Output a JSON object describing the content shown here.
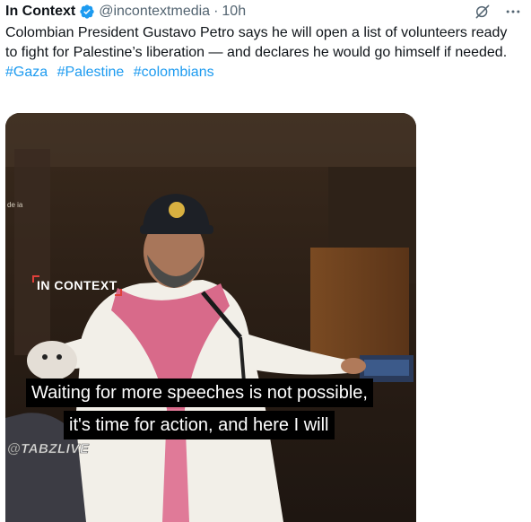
{
  "tweet": {
    "author_name": "In Context",
    "handle": "@incontextmedia",
    "separator": "·",
    "time": "10h",
    "text": "Colombian President Gustavo Petro says he will open a list of volunteers ready to fight for Palestine’s liberation — and declares he would go himself if needed.",
    "hashtags": [
      "#Gaza",
      "#Palestine",
      "#colombians"
    ],
    "icons": {
      "verified": "verified-badge-icon",
      "grok": "grok-icon",
      "more": "more-icon"
    },
    "colors": {
      "link": "#1d9bf0",
      "verified": "#1d9bf0",
      "muted": "#536471"
    }
  },
  "media": {
    "watermark_top": "IN CONTEXT",
    "subtitles": [
      "Waiting for more speeches is not possible,",
      "it's time for action, and here I will"
    ],
    "watermark_bottom": "@TABZLIVE",
    "side_text": "de\nia"
  }
}
